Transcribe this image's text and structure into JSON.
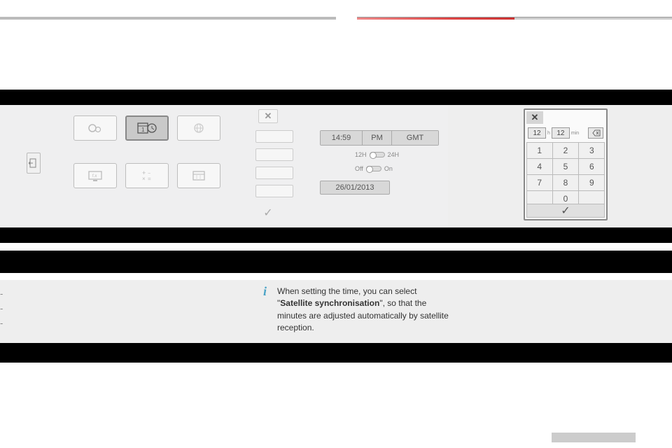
{
  "time_panel": {
    "time_value": "14:59",
    "ampm": "PM",
    "tz": "GMT",
    "format_left": "12H",
    "format_right": "24H",
    "sync_off": "Off",
    "sync_on": "On",
    "date_value": "26/01/2013"
  },
  "keypad": {
    "hour": "12",
    "hour_label": "h",
    "min": "12",
    "min_label": "min",
    "keys": [
      "1",
      "2",
      "3",
      "4",
      "5",
      "6",
      "7",
      "8",
      "9",
      "",
      "0",
      ""
    ],
    "ok": "✓",
    "close": "✕",
    "backspace": "⌫"
  },
  "info_note": {
    "icon": "i",
    "line1": "When setting the time, you can select",
    "bold": "Satellite synchronisation",
    "line2": "\", so that the minutes are adjusted automatically by satellite reception."
  }
}
